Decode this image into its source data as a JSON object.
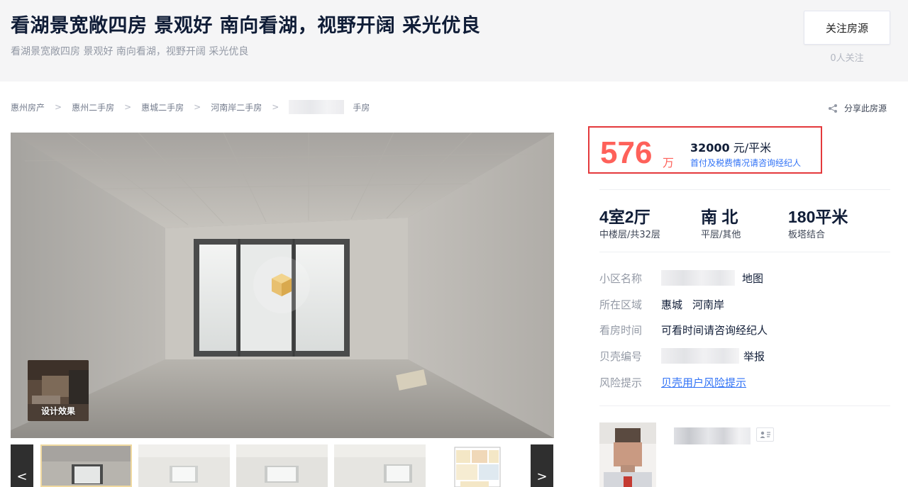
{
  "header": {
    "title": "看湖景宽敞四房 景观好 南向看湖，视野开阔 采光优良",
    "subtitle": "看湖景宽敞四房 景观好 南向看湖，视野开阔 采光优良",
    "follow_label": "关注房源",
    "follow_count": "0人关注"
  },
  "breadcrumb": {
    "items": [
      "惠州房产",
      "惠州二手房",
      "惠城二手房",
      "河南岸二手房"
    ],
    "last_suffix": "手房",
    "separator": ">"
  },
  "share_label": "分享此房源",
  "gallery": {
    "design_label": "设计效果",
    "prev": "<",
    "next": ">"
  },
  "price": {
    "total": "576",
    "total_unit": "万",
    "unit_price": "32000",
    "unit_price_suffix": " 元/平米",
    "tax_note": "首付及税费情况请咨询经纪人"
  },
  "room": {
    "layout_main": "4室2厅",
    "layout_sub": "中楼层/共32层",
    "orientation_main": "南 北",
    "orientation_sub": "平层/其他",
    "area_main": "180平米",
    "area_sub": "板塔结合"
  },
  "info": {
    "community_label": "小区名称",
    "community_map": "地图",
    "area_label": "所在区域",
    "area_district": "惠城",
    "area_sub": "河南岸",
    "visit_label": "看房时间",
    "visit_value": "可看时间请咨询经纪人",
    "id_label": "贝壳编号",
    "id_report": "举报",
    "risk_label": "风险提示",
    "risk_link": "贝壳用户风险提示"
  },
  "colors": {
    "price_red": "#fe615a",
    "highlight_border": "#e4393c",
    "link_blue": "#3072f6",
    "title_dark": "#101d37"
  }
}
